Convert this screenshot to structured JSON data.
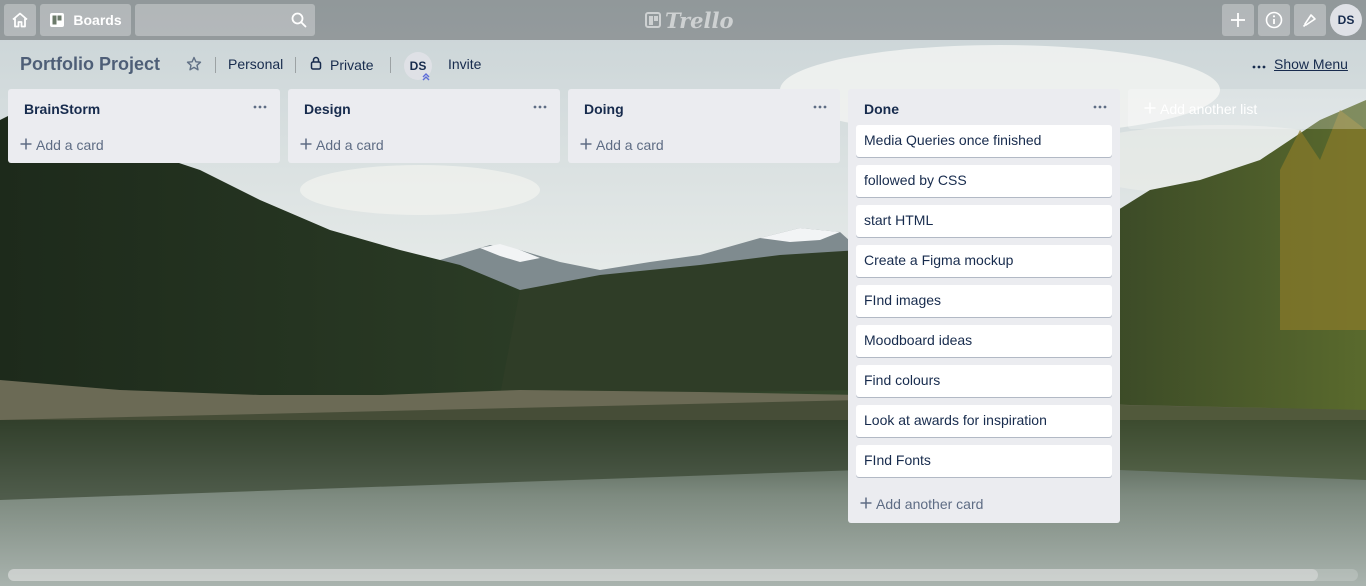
{
  "nav": {
    "boards_label": "Boards",
    "search_placeholder": "",
    "logo_text": "Trello",
    "user_initials": "DS"
  },
  "board": {
    "title": "Portfolio Project",
    "team": "Personal",
    "visibility": "Private",
    "member_initials": "DS",
    "invite_label": "Invite",
    "show_menu_label": "Show Menu"
  },
  "lists": [
    {
      "title": "BrainStorm",
      "cards": [],
      "add_label": "Add a card"
    },
    {
      "title": "Design",
      "cards": [],
      "add_label": "Add a card"
    },
    {
      "title": "Doing",
      "cards": [],
      "add_label": "Add a card"
    },
    {
      "title": "Done",
      "cards": [
        "Media Queries once finished",
        "followed by CSS",
        "start HTML",
        "Create a Figma mockup",
        "FInd images",
        "Moodboard ideas",
        "Find colours",
        "Look at awards for inspiration",
        "FInd Fonts"
      ],
      "add_label": "Add another card"
    }
  ],
  "add_list_label": "Add another list",
  "icons": {
    "home": "home-icon",
    "boards": "boards-icon",
    "search": "search-icon",
    "create": "plus-icon",
    "info": "info-icon",
    "notifications": "bell-icon",
    "star": "star-icon",
    "lock": "lock-icon",
    "list_menu": "ellipsis-icon"
  },
  "colors": {
    "list_bg": "#ebecf0",
    "card_bg": "#ffffff",
    "text": "#172b4d",
    "muted_text": "#5e6c84"
  }
}
